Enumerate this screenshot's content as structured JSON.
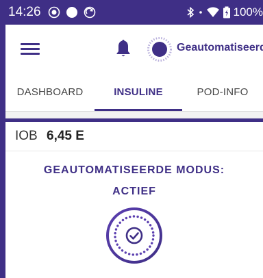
{
  "status_bar": {
    "time": "14:26",
    "battery": "100%",
    "icons": [
      "record-icon",
      "circle-icon",
      "sync-icon",
      "bluetooth-icon",
      "wifi-icon",
      "battery-icon"
    ]
  },
  "app_bar": {
    "mode_label": "Geautomatiseerd",
    "icons": [
      "menu-icon",
      "bell-icon",
      "automated-mode-icon"
    ]
  },
  "tabs": [
    {
      "label": "DASHBOARD",
      "active": false
    },
    {
      "label": "INSULINE",
      "active": true
    },
    {
      "label": "POD-INFO",
      "active": false
    }
  ],
  "card": {
    "iob_label": "IOB",
    "iob_value": "6,45 E",
    "mode_title": "GEAUTOMATISEERDE MODUS:",
    "mode_status": "ACTIEF",
    "mode_icon": "check-circle-icon"
  },
  "colors": {
    "brand": "#3f2f86",
    "background": "#ffffff",
    "content_background": "#f2f2f2"
  }
}
